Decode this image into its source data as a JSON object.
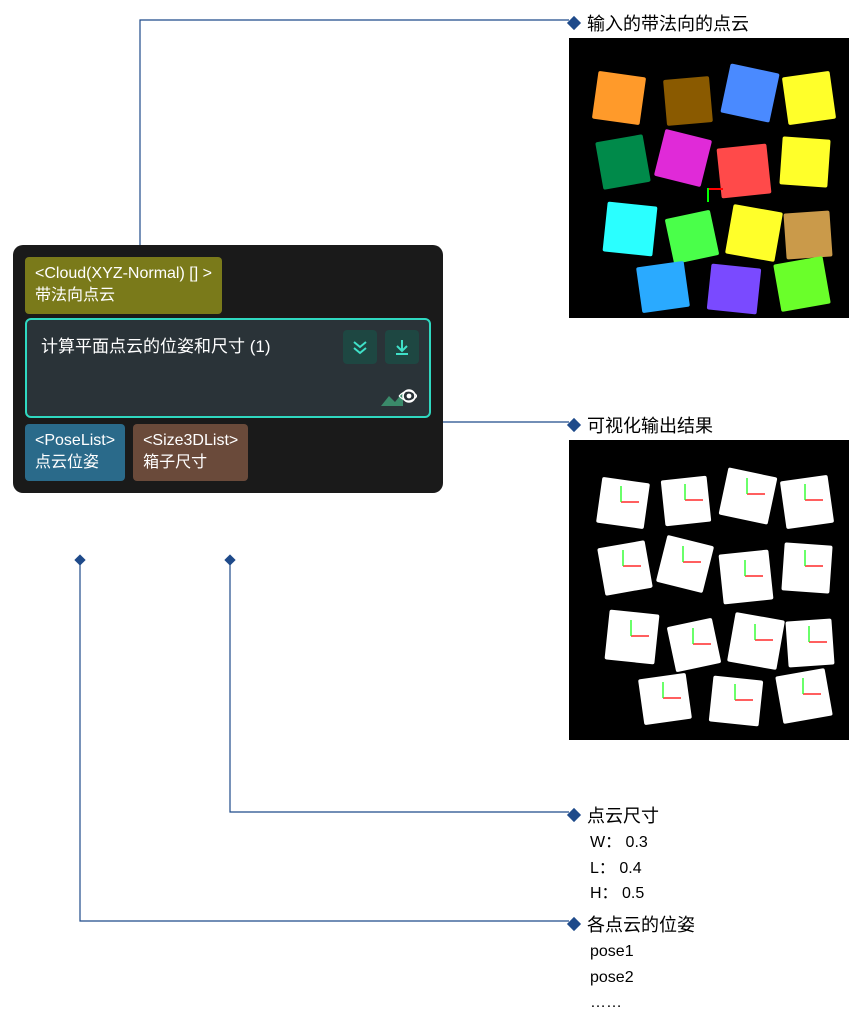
{
  "annotations": {
    "input": "输入的带法向的点云",
    "viz": "可视化输出结果",
    "size": "点云尺寸",
    "pose": "各点云的位姿"
  },
  "node": {
    "input_port_type": "<Cloud(XYZ-Normal) [] >",
    "input_port_label": "带法向点云",
    "title": "计算平面点云的位姿和尺寸 (1)",
    "output_pose_type": "<PoseList>",
    "output_pose_label": "点云位姿",
    "output_size_type": "<Size3DList>",
    "output_size_label": "箱子尺寸"
  },
  "size_values": {
    "w": "W： 0.3",
    "l": "L：   0.4",
    "h": "H： 0.5"
  },
  "pose_values": {
    "p1": "pose1",
    "p2": "pose2",
    "ellipsis": "……"
  }
}
